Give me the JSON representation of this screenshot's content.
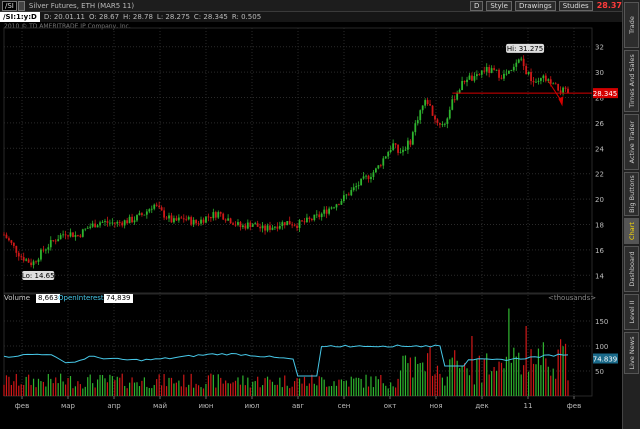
{
  "toolbar": {
    "symbol": "/SI",
    "description": "Silver Futures, ETH (MAR5 11)",
    "aggregation": "D",
    "style_label": "Style",
    "drawings_label": "Drawings",
    "studies_label": "Studies",
    "last_price": "28.37"
  },
  "ohlc": {
    "symbol": "/SI:1:y:D",
    "date": "D: 20.01.11",
    "open": "O: 28.67",
    "high": "H: 28.78",
    "low": "L: 28.275",
    "close": "C: 28.345",
    "range": "R: 0.505"
  },
  "copyright": "2010 © TD AMERITRADE IP Company, Inc.",
  "price_axis": [
    "32",
    "30",
    "28",
    "26",
    "24",
    "22",
    "20",
    "18",
    "16",
    "14"
  ],
  "price_marker": "28.345",
  "high_label": "Hi: 31.275",
  "low_label": "Lo: 14.65",
  "volume_pane": {
    "volume_label": "Volume",
    "volume_value": "8,663",
    "oi_label": "OpenInterest",
    "oi_value": "74,839",
    "units": "<thousands>",
    "axis": [
      "150",
      "100",
      "50"
    ],
    "oi_marker": "74.839"
  },
  "x_axis": [
    "фев",
    "мар",
    "апр",
    "май",
    "июн",
    "июл",
    "авг",
    "сен",
    "окт",
    "ноя",
    "дек",
    "11",
    "фев"
  ],
  "side_tabs": [
    "Trade",
    "Times And Sales",
    "Active Trader",
    "Big Buttons",
    "Chart",
    "Dashboard",
    "Level II",
    "Live News"
  ],
  "colors": {
    "up": "#2fb52f",
    "down": "#d01818",
    "oi_line": "#47c8e8",
    "marker": "#d50000",
    "active_tab": "#ffde00"
  },
  "chart_data": {
    "type": "candlestick",
    "x_range": [
      "2010-01",
      "2011-02"
    ],
    "price_range": [
      13,
      33
    ],
    "high": 31.275,
    "low": 14.65,
    "last": 28.345,
    "price_path": [
      [
        0,
        17.2
      ],
      [
        0.03,
        15.5
      ],
      [
        0.05,
        14.9
      ],
      [
        0.07,
        16.0
      ],
      [
        0.09,
        16.8
      ],
      [
        0.11,
        17.4
      ],
      [
        0.13,
        17.1
      ],
      [
        0.15,
        17.8
      ],
      [
        0.17,
        18.2
      ],
      [
        0.2,
        18.1
      ],
      [
        0.23,
        18.4
      ],
      [
        0.25,
        18.9
      ],
      [
        0.265,
        19.6
      ],
      [
        0.28,
        18.9
      ],
      [
        0.3,
        18.2
      ],
      [
        0.32,
        18.5
      ],
      [
        0.34,
        18.1
      ],
      [
        0.36,
        18.6
      ],
      [
        0.38,
        18.9
      ],
      [
        0.4,
        18.4
      ],
      [
        0.42,
        17.8
      ],
      [
        0.44,
        18.1
      ],
      [
        0.46,
        17.6
      ],
      [
        0.48,
        17.9
      ],
      [
        0.5,
        18.2
      ],
      [
        0.52,
        18.0
      ],
      [
        0.54,
        18.3
      ],
      [
        0.56,
        18.7
      ],
      [
        0.58,
        19.4
      ],
      [
        0.6,
        20.0
      ],
      [
        0.62,
        20.8
      ],
      [
        0.64,
        21.6
      ],
      [
        0.66,
        22.3
      ],
      [
        0.67,
        23.0
      ],
      [
        0.68,
        23.7
      ],
      [
        0.69,
        24.3
      ],
      [
        0.7,
        23.6
      ],
      [
        0.72,
        24.5
      ],
      [
        0.73,
        26.0
      ],
      [
        0.74,
        27.2
      ],
      [
        0.75,
        27.8
      ],
      [
        0.765,
        26.2
      ],
      [
        0.78,
        25.8
      ],
      [
        0.79,
        27.0
      ],
      [
        0.8,
        28.2
      ],
      [
        0.81,
        28.9
      ],
      [
        0.82,
        29.6
      ],
      [
        0.835,
        29.4
      ],
      [
        0.85,
        30.2
      ],
      [
        0.87,
        30.0
      ],
      [
        0.885,
        29.7
      ],
      [
        0.9,
        30.0
      ],
      [
        0.915,
        31.0
      ],
      [
        0.925,
        30.1
      ],
      [
        0.935,
        29.4
      ],
      [
        0.945,
        28.9
      ],
      [
        0.955,
        29.6
      ],
      [
        0.97,
        29.0
      ],
      [
        0.985,
        28.6
      ],
      [
        1.0,
        28.35
      ]
    ]
  }
}
